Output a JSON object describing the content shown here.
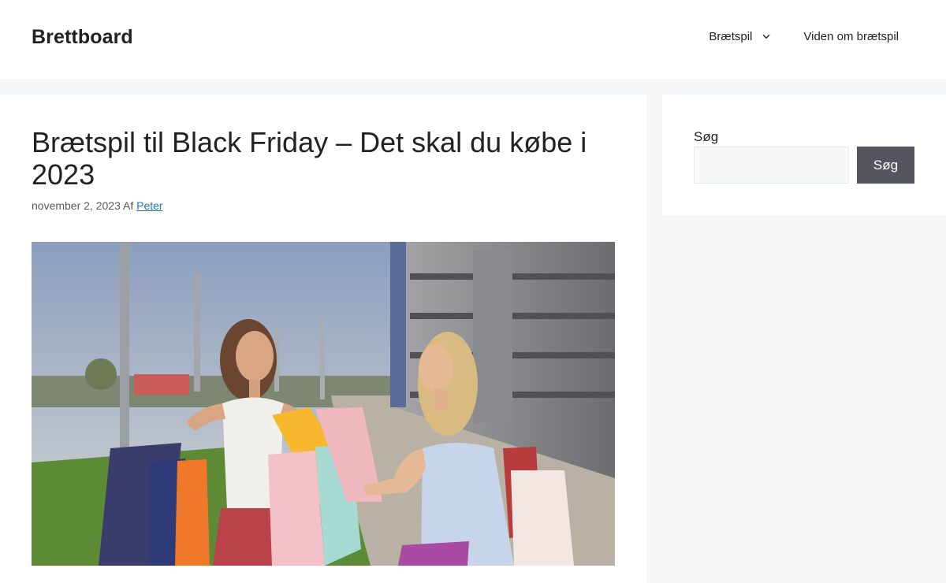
{
  "header": {
    "site_title": "Brettboard",
    "nav": [
      {
        "label": "Brætspil",
        "icon": "chevron-down-icon"
      },
      {
        "label": "Viden om brætspil"
      }
    ]
  },
  "article": {
    "title": "Brætspil til Black Friday – Det skal du købe i 2023",
    "date": "november 2, 2023",
    "author_prefix": "Af",
    "author": "Peter"
  },
  "sidebar": {
    "search": {
      "label": "Søg",
      "value": "",
      "button_label": "Søg"
    }
  },
  "colors": {
    "page_background": "#f6f7f9",
    "link": "#1e73be",
    "search_button": "#55555e"
  }
}
